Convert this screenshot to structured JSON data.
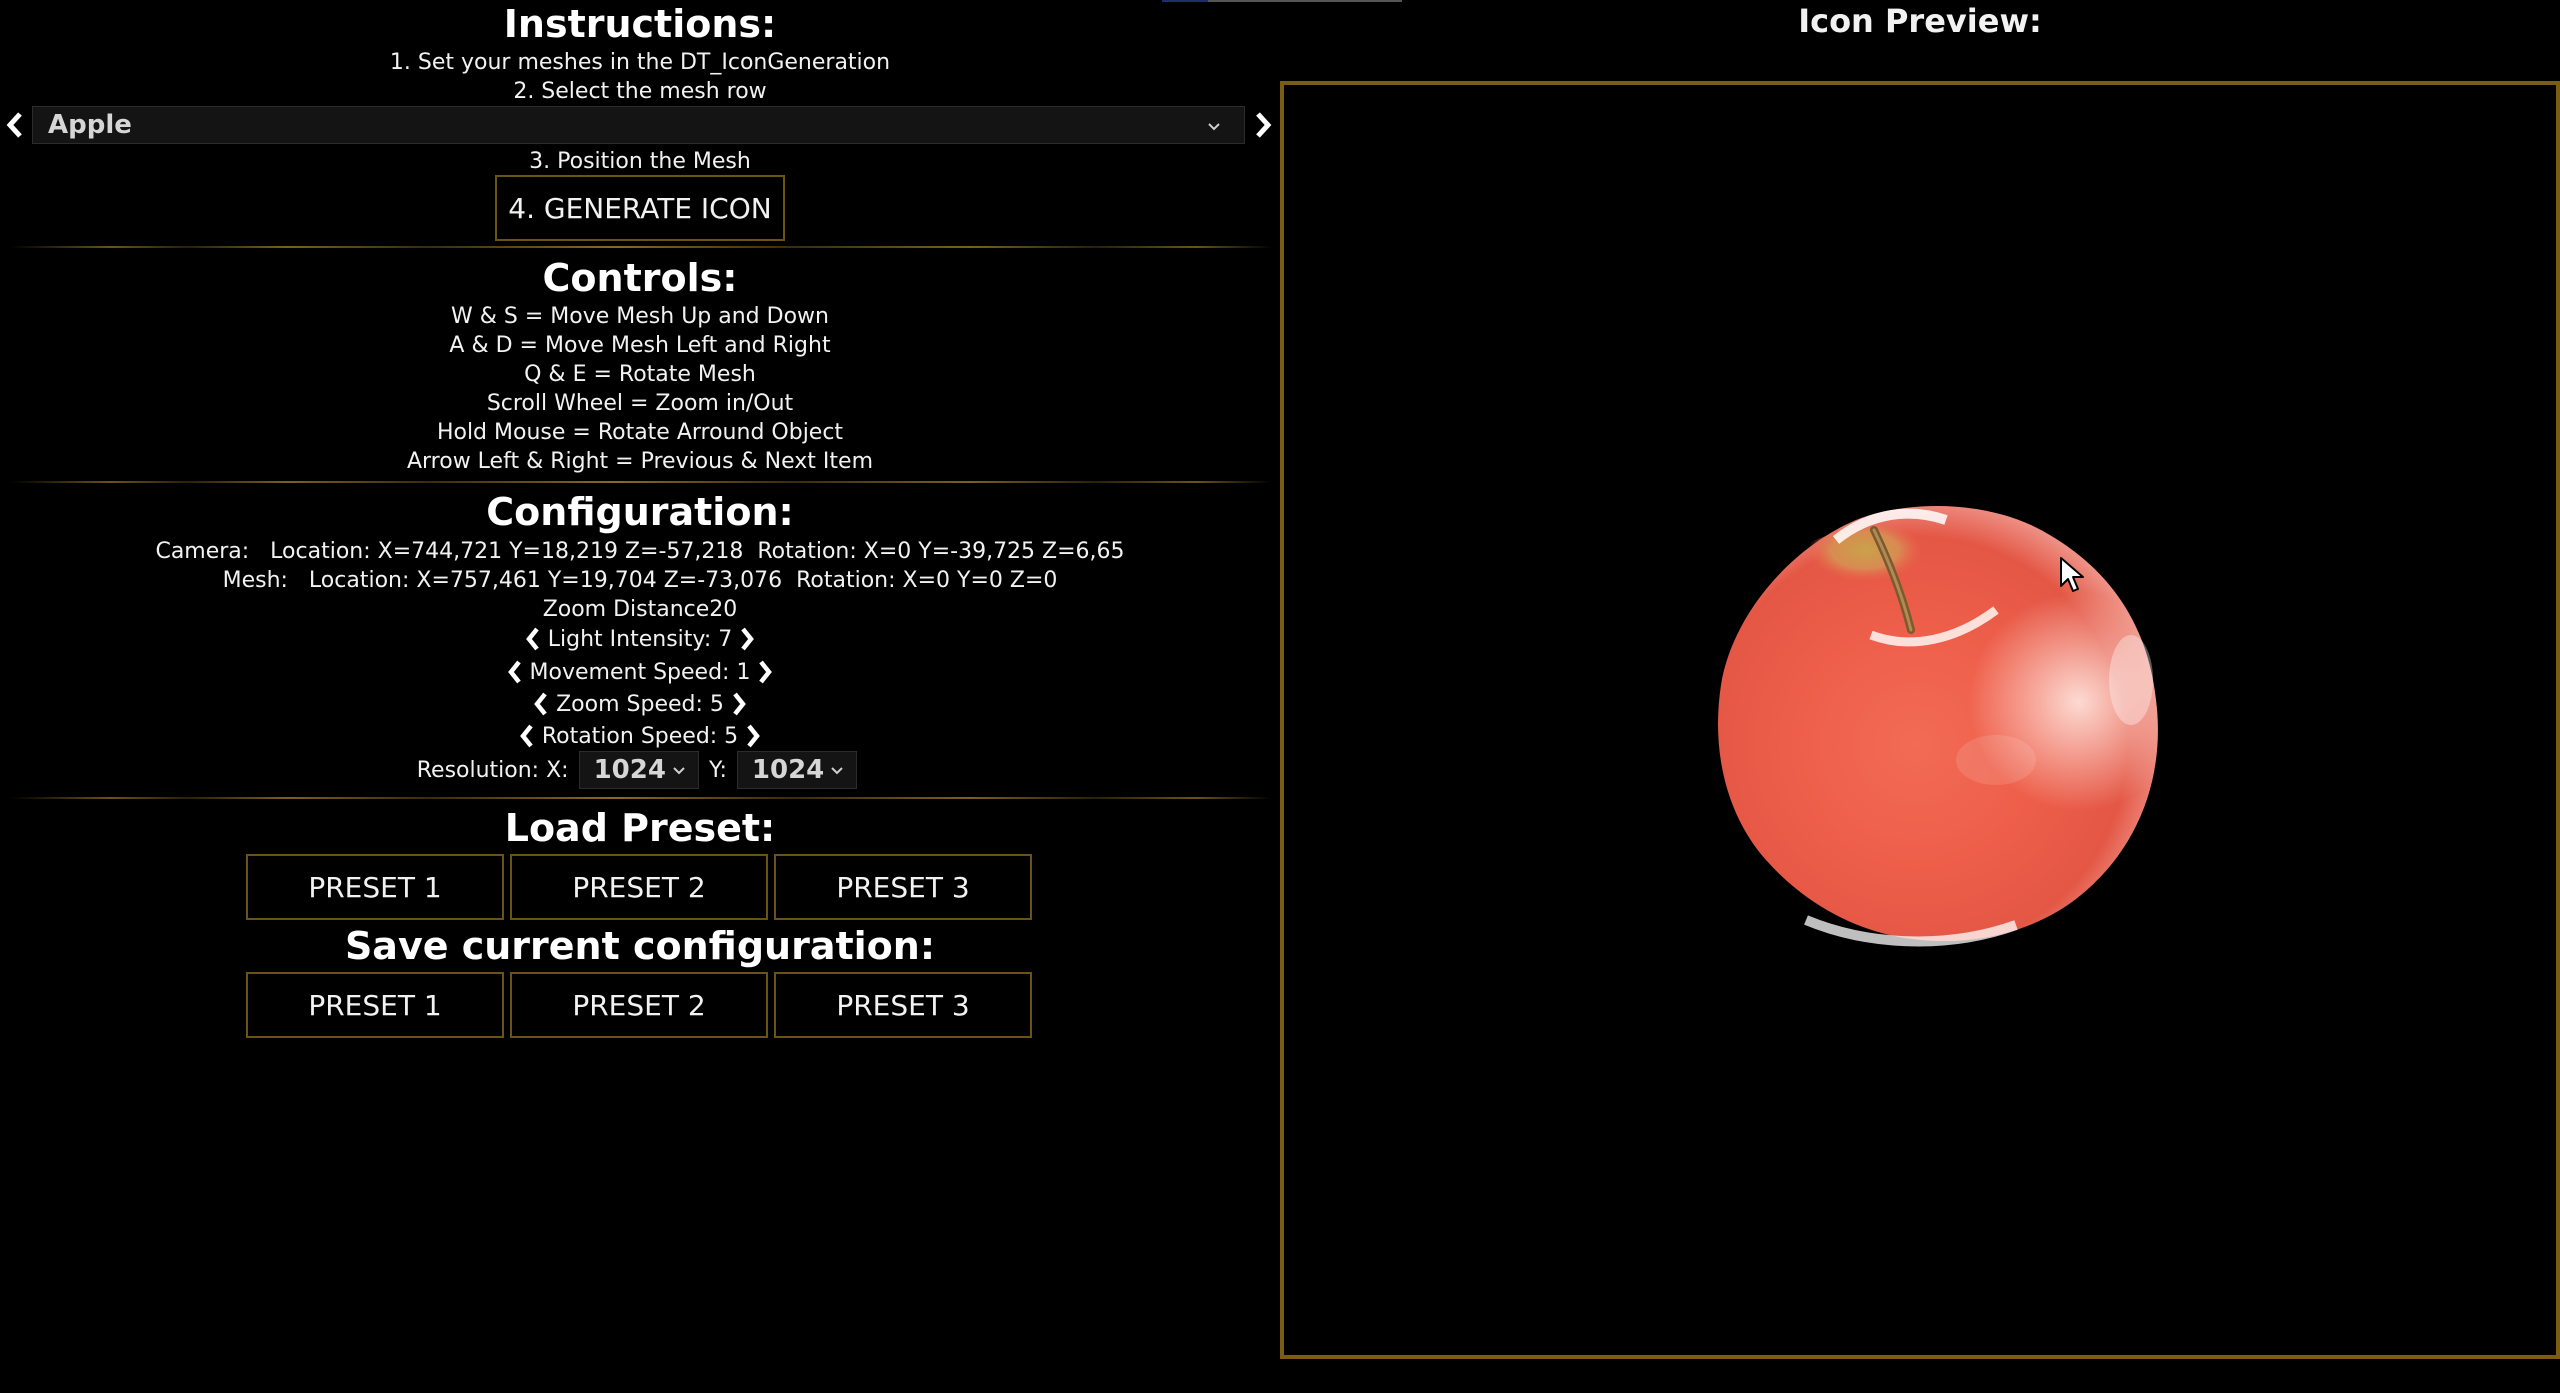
{
  "instructions": {
    "title": "Instructions:",
    "step1": "1. Set your meshes in the DT_IconGeneration",
    "step2": "2. Select the mesh row",
    "step3": "3. Position the Mesh",
    "generate_button": "4. GENERATE ICON"
  },
  "mesh_select": {
    "value": "Apple",
    "prev_icon": "chevron-left-icon",
    "next_icon": "chevron-right-icon"
  },
  "controls": {
    "title": "Controls:",
    "lines": [
      "W & S = Move Mesh Up and Down",
      "A & D = Move Mesh Left and Right",
      "Q & E = Rotate Mesh",
      "Scroll Wheel = Zoom in/Out",
      "Hold Mouse = Rotate Arround Object",
      "Arrow Left & Right = Previous & Next Item"
    ]
  },
  "configuration": {
    "title": "Configuration:",
    "camera_line": "Camera:   Location: X=744,721 Y=18,219 Z=-57,218  Rotation: X=0 Y=-39,725 Z=6,65",
    "mesh_line": "Mesh:   Location: X=757,461 Y=19,704 Z=-73,076  Rotation: X=0 Y=0 Z=0",
    "zoom_distance": "Zoom Distance20",
    "light_intensity": "Light Intensity: 7",
    "movement_speed": "Movement Speed: 1",
    "zoom_speed": "Zoom Speed: 5",
    "rotation_speed": "Rotation Speed: 5",
    "resolution_label": "Resolution: X:",
    "resolution_y_label": "Y:",
    "resolution_x": "1024",
    "resolution_y": "1024"
  },
  "load_preset": {
    "title": "Load Preset:",
    "buttons": [
      "PRESET 1",
      "PRESET 2",
      "PRESET 3"
    ]
  },
  "save_preset": {
    "title": "Save current configuration:",
    "buttons": [
      "PRESET 1",
      "PRESET 2",
      "PRESET 3"
    ]
  },
  "preview": {
    "title": "Icon Preview:",
    "object_icon": "apple-icon"
  },
  "colors": {
    "background": "#000000",
    "accent_border": "#7a5d12",
    "text": "#f2f2f2"
  }
}
